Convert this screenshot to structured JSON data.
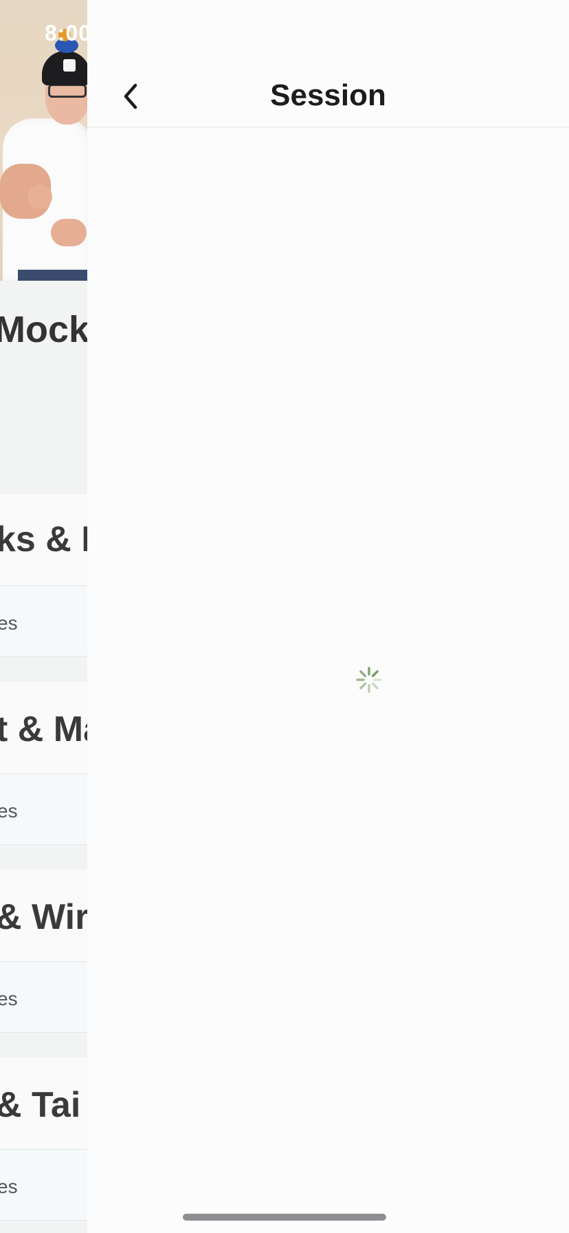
{
  "background_screen": {
    "status_time": "8:00",
    "title": "Mock",
    "sections": [
      {
        "title": "ks & P",
        "row_label": "es"
      },
      {
        "title": "t & Ma",
        "row_label": "es"
      },
      {
        "title": "& Wir",
        "row_label": "es"
      },
      {
        "title": " & Tai",
        "row_label": "es"
      }
    ]
  },
  "session_screen": {
    "title": "Session",
    "back_icon": "chevron-left-icon",
    "loading": true,
    "spinner_color": "#6f9a5a"
  },
  "colors": {
    "sheet_background": "#fcfcfc",
    "title_text": "#1c1c1e",
    "home_indicator": "#8e8e93"
  }
}
